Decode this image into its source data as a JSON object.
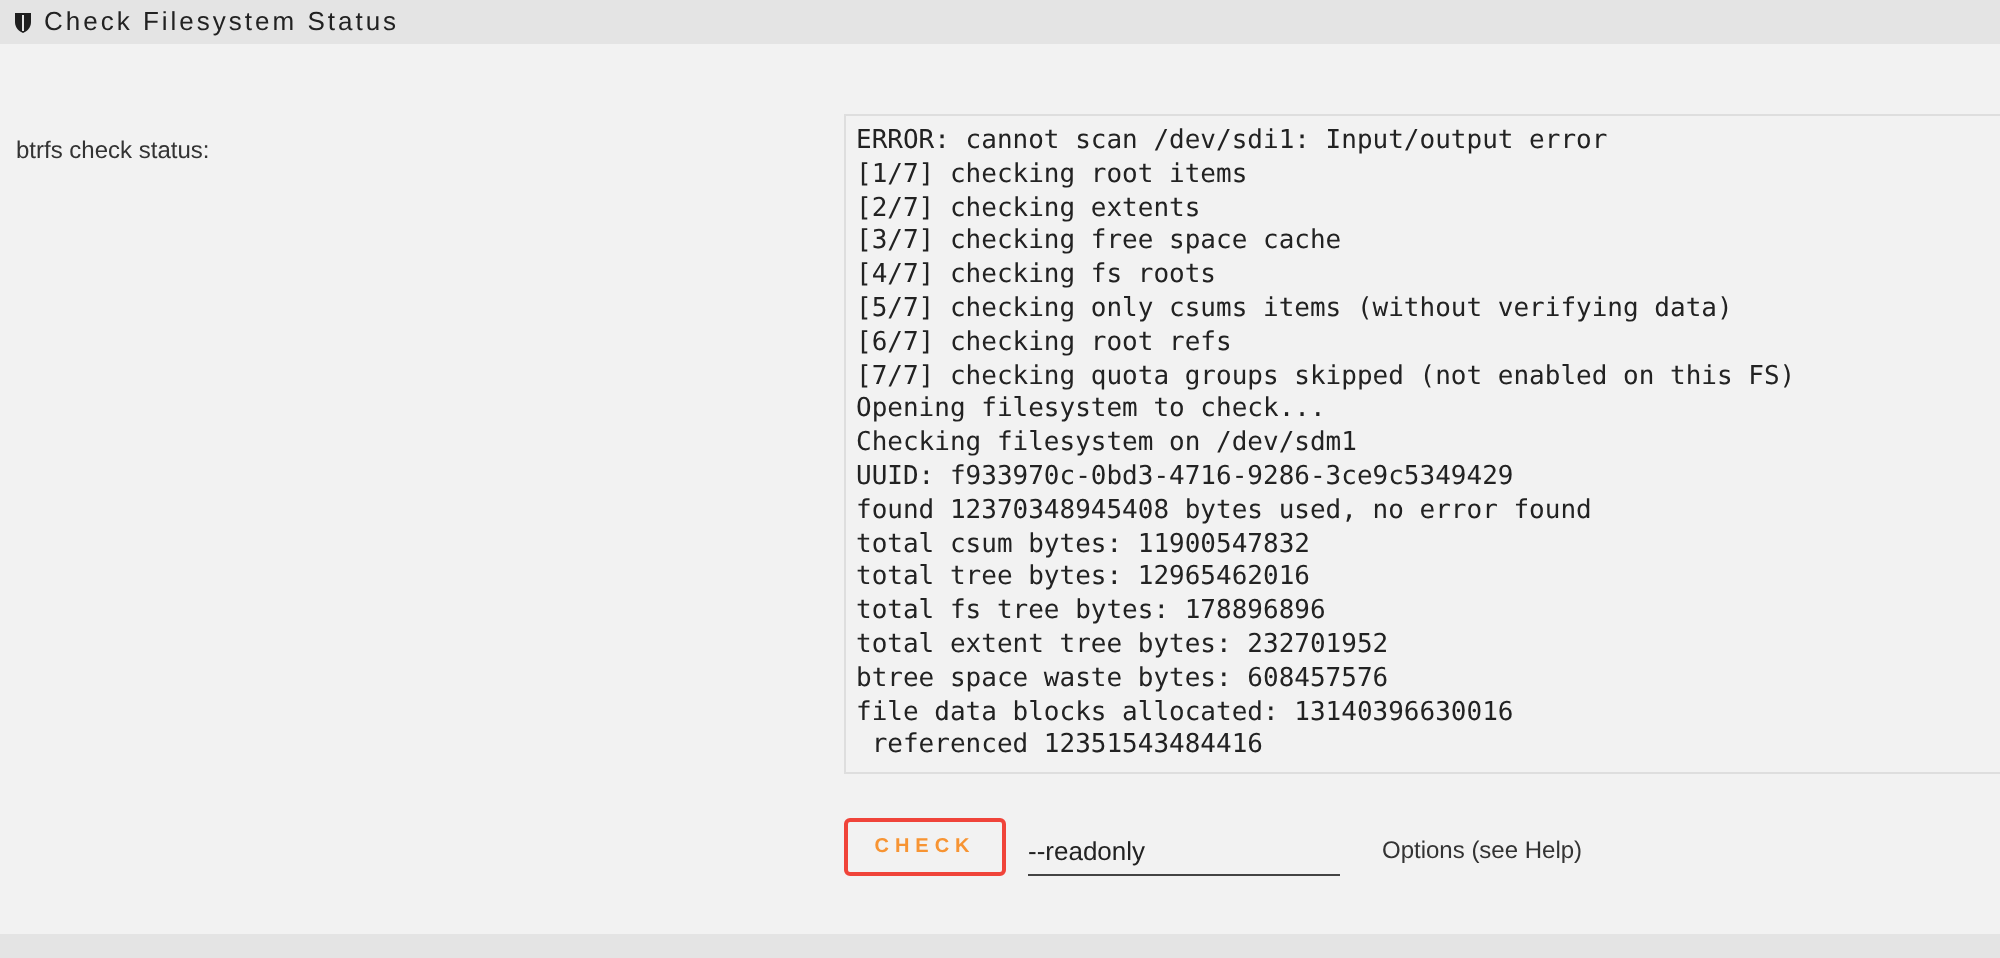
{
  "header": {
    "title": "Check Filesystem Status"
  },
  "status": {
    "label": "btrfs check status:",
    "output": [
      "ERROR: cannot scan /dev/sdi1: Input/output error",
      "[1/7] checking root items",
      "[2/7] checking extents",
      "[3/7] checking free space cache",
      "[4/7] checking fs roots",
      "[5/7] checking only csums items (without verifying data)",
      "[6/7] checking root refs",
      "[7/7] checking quota groups skipped (not enabled on this FS)",
      "Opening filesystem to check...",
      "Checking filesystem on /dev/sdm1",
      "UUID: f933970c-0bd3-4716-9286-3ce9c5349429",
      "found 12370348945408 bytes used, no error found",
      "total csum bytes: 11900547832",
      "total tree bytes: 12965462016",
      "total fs tree bytes: 178896896",
      "total extent tree bytes: 232701952",
      "btree space waste bytes: 608457576",
      "file data blocks allocated: 13140396630016",
      " referenced 12351543484416"
    ]
  },
  "check_button": {
    "label": "CHECK"
  },
  "options_field": {
    "value": "--readonly"
  },
  "options_hint": "Options (see Help)"
}
